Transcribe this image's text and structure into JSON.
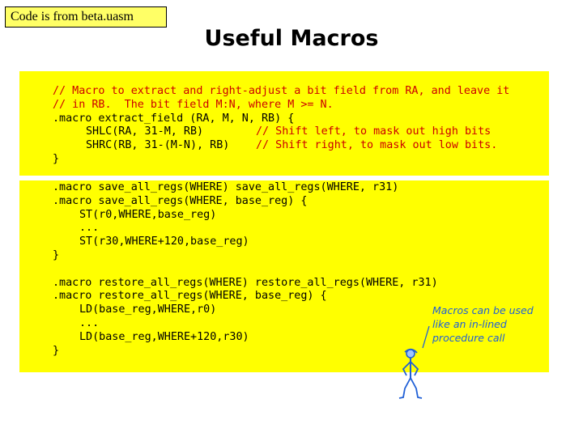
{
  "source_tag": "Code is from beta.uasm",
  "title": "Useful Macros",
  "box1": {
    "comment_line_1": "// Macro to extract and right-adjust a bit field from RA, and leave it",
    "comment_line_2": "// in RB.  The bit field M:N, where M >= N.",
    "macro_header": ".macro extract_field (RA, M, N, RB) {",
    "shlc_code": "SHLC(RA, 31-M, RB)",
    "shlc_comment": "// Shift left, to mask out high bits",
    "shrc_code": "SHRC(RB, 31-(M-N), RB)",
    "shrc_comment": "// Shift right, to mask out low bits.",
    "close": "}"
  },
  "box2": {
    "save_line_1": ".macro save_all_regs(WHERE) save_all_regs(WHERE, r31)",
    "save_line_2": ".macro save_all_regs(WHERE, base_reg) {",
    "save_body_1": "ST(r0,WHERE,base_reg)",
    "save_body_2": "...",
    "save_body_3": "ST(r30,WHERE+120,base_reg)",
    "save_close": "}",
    "restore_line_1": ".macro restore_all_regs(WHERE) restore_all_regs(WHERE, r31)",
    "restore_line_2": ".macro restore_all_regs(WHERE, base_reg) {",
    "restore_body_1": "LD(base_reg,WHERE,r0)",
    "restore_body_2": "...",
    "restore_body_3": "LD(base_reg,WHERE+120,r30)",
    "restore_close": "}"
  },
  "note": {
    "line_1": "Macros can be used",
    "line_2": "like an in-lined",
    "line_3": "procedure call"
  },
  "colors": {
    "code_background": "#ffff00",
    "tag_background": "#ffff66",
    "comment": "#cc0000",
    "note": "#1f5fd6"
  },
  "icons": {
    "figure": "stick-figure-icon"
  }
}
